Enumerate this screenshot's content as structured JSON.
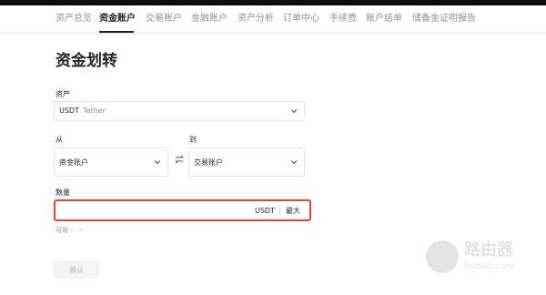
{
  "tabs": [
    {
      "label": "资产总览"
    },
    {
      "label": "资金账户"
    },
    {
      "label": "交易账户"
    },
    {
      "label": "金融账户"
    },
    {
      "label": "资产分析"
    },
    {
      "label": "订单中心"
    },
    {
      "label": "手续费"
    },
    {
      "label": "账户结单"
    },
    {
      "label": "储备金证明报告"
    }
  ],
  "active_tab": "资金账户",
  "page_title": "资金划转",
  "asset": {
    "label": "资产",
    "symbol": "USDT",
    "name": "Tether"
  },
  "from": {
    "label": "从",
    "value": "资金账户"
  },
  "to": {
    "label": "到",
    "value": "交易账户"
  },
  "amount": {
    "label": "数量",
    "value": "",
    "unit": "USDT",
    "max_label": "最大"
  },
  "available": {
    "label": "可用",
    "value": "--"
  },
  "confirm_label": "确认",
  "watermark": {
    "title": "路由器",
    "domain": "luyouqi.com"
  },
  "colors": {
    "accent_outline": "#e04538",
    "text": "#1e2329",
    "muted": "#8b929c"
  }
}
